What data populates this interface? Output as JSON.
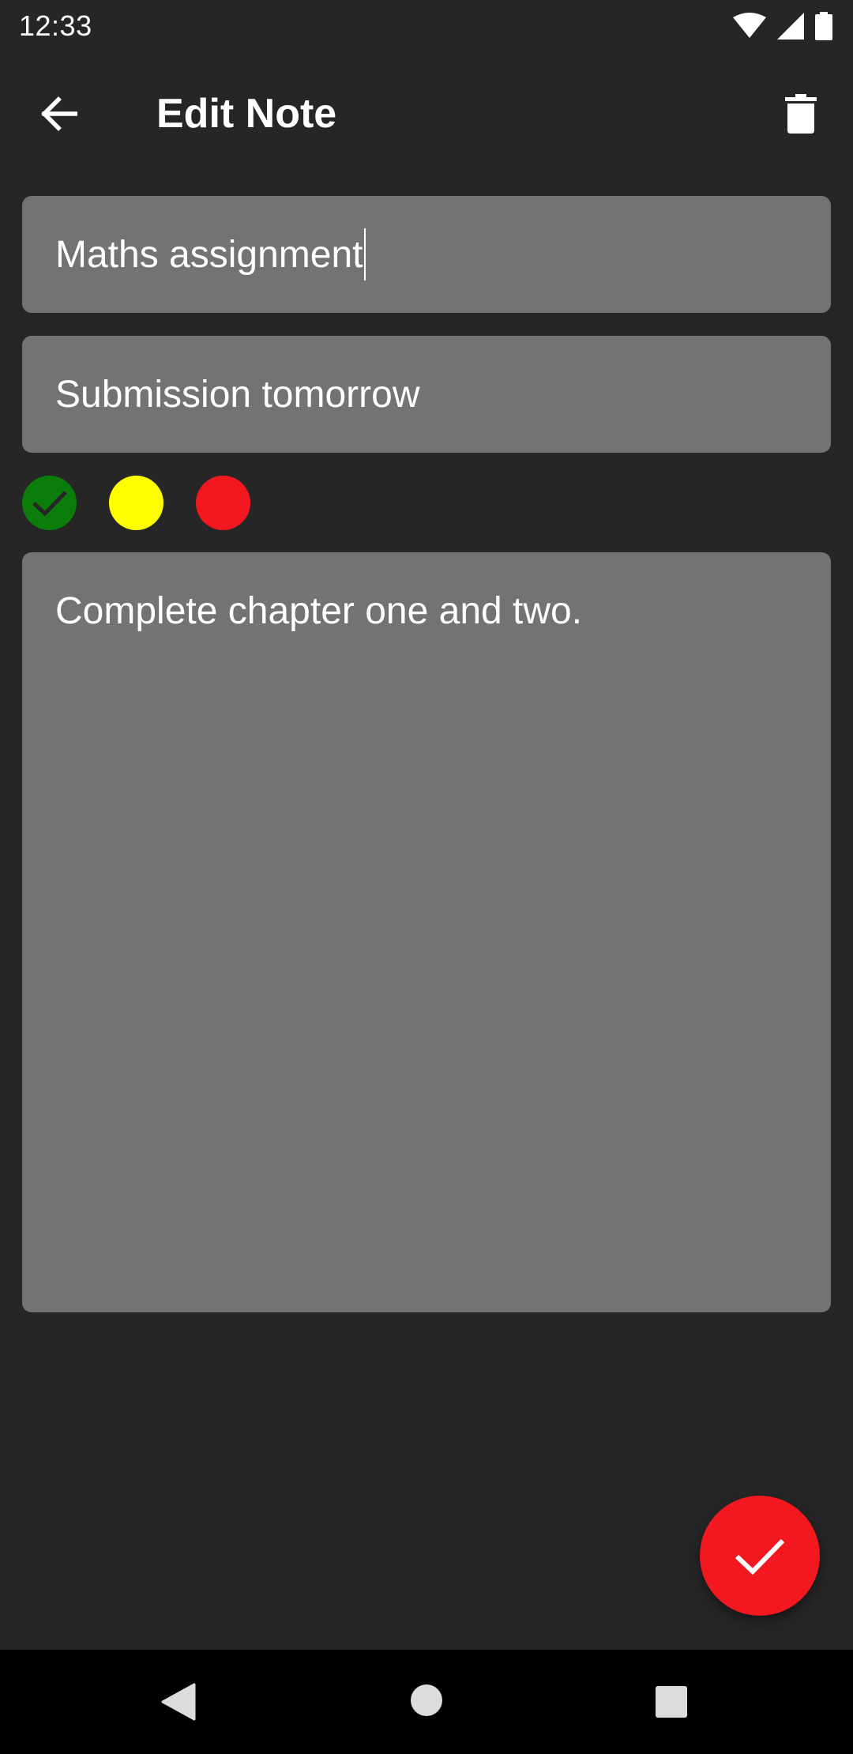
{
  "status_bar": {
    "time": "12:33"
  },
  "toolbar": {
    "title": "Edit Note"
  },
  "note": {
    "title_value": "Maths assignment",
    "subtitle_value": "Submission tomorrow",
    "body_value": "Complete chapter one and two."
  },
  "colors": {
    "options": [
      {
        "name": "green",
        "hex": "#0b7d0b",
        "selected": true
      },
      {
        "name": "yellow",
        "hex": "#ffff00",
        "selected": false
      },
      {
        "name": "red",
        "hex": "#f3181f",
        "selected": false
      }
    ]
  },
  "fab": {
    "icon": "check-icon",
    "color": "#f3181f"
  },
  "icons": {
    "back": "arrow-left-icon",
    "delete": "trash-icon",
    "nav_back": "triangle-back-icon",
    "nav_home": "circle-home-icon",
    "nav_recents": "square-recents-icon"
  }
}
